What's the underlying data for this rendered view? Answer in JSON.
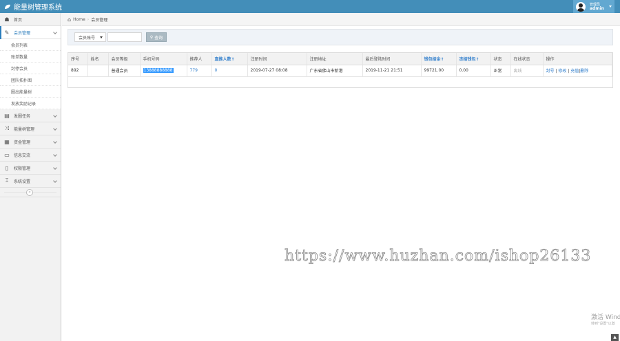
{
  "app": {
    "title": "能量树管理系统"
  },
  "user": {
    "role": "管理员",
    "name": "admin"
  },
  "sidebar": {
    "items": [
      {
        "label": "首页",
        "icon": "tachometer-icon"
      },
      {
        "label": "会员管理",
        "icon": "edit-icon",
        "open": true
      },
      {
        "label": "发圈任务",
        "icon": "book-icon"
      },
      {
        "label": "能量树管理",
        "icon": "random-icon"
      },
      {
        "label": "资金管理",
        "icon": "calendar-icon"
      },
      {
        "label": "信息交流",
        "icon": "keyboard-icon"
      },
      {
        "label": "权限管理",
        "icon": "file-icon"
      },
      {
        "label": "系统设置",
        "icon": "wrench-icon"
      }
    ],
    "submenu": [
      "会员列表",
      "账单数量",
      "封停会员",
      "团队拓扑图",
      "圈出能量树",
      "发放奖励记录"
    ]
  },
  "breadcrumb": {
    "home": "Home",
    "current": "会员管理"
  },
  "search": {
    "select_value": "会员账号",
    "button_label": "查询"
  },
  "table": {
    "headers": [
      "序号",
      "姓名",
      "会员等级",
      "手机号码",
      "推荐人",
      "直推人数↑",
      "注册时间",
      "注册地址",
      "最后登陆时间",
      "钱包结余↑",
      "冻结钱包↑",
      "状态",
      "在线状态",
      "操作"
    ],
    "rows": [
      {
        "id": "892",
        "name": "",
        "level": "普通会员",
        "phone": "13888888888",
        "referrer": "779",
        "direct": "0",
        "reg_time": "2019-07-27 08:08",
        "reg_addr": "广东省佛山市新港",
        "last_login": "2019-11-21 21:51",
        "wallet": "99721.00",
        "frozen": "0.00",
        "status": "正常",
        "online": "离线",
        "actions": [
          "封号",
          "修改",
          "充值",
          "删除"
        ]
      }
    ]
  },
  "watermark": "https://www.huzhan.com/ishop26133",
  "activation": {
    "title": "激活 Wind",
    "subtitle": "转到\"设置\"以激"
  }
}
